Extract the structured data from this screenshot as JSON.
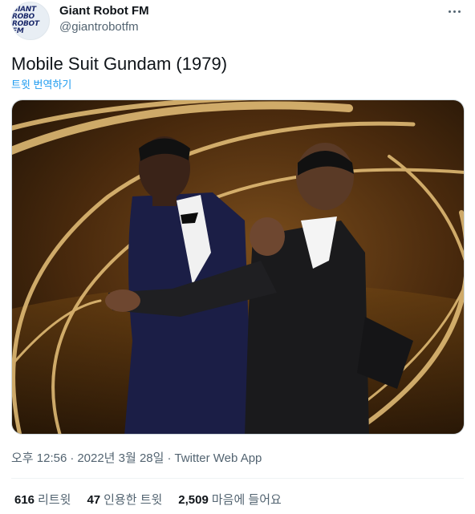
{
  "author": {
    "display_name": "Giant Robot FM",
    "handle": "@giantrobotfm",
    "avatar_text": [
      "GIANT ROBO",
      "ROBOT FM"
    ]
  },
  "tweet": {
    "text": "Mobile Suit Gundam (1979)",
    "translate_label": "트윗 번역하기",
    "media_icon": "photo"
  },
  "meta": {
    "time": "오후 12:56",
    "date": "2022년 3월 28일",
    "separator": "·",
    "source": "Twitter Web App"
  },
  "stats": {
    "retweets": {
      "count": "616",
      "label": "리트윗"
    },
    "quotes": {
      "count": "47",
      "label": "인용한 트윗"
    },
    "likes": {
      "count": "2,509",
      "label": "마음에 들어요"
    }
  },
  "colors": {
    "accent": "#1d9bf0",
    "secondary_text": "#536471",
    "primary_text": "#0f1419"
  },
  "icons": {
    "more": "more-horizontal-icon"
  }
}
